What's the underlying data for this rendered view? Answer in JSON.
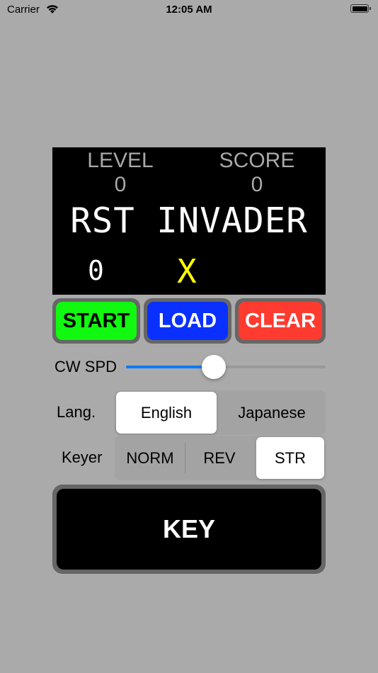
{
  "status_bar": {
    "carrier": "Carrier",
    "time": "12:05 AM",
    "icons": [
      "wifi-icon",
      "battery-icon"
    ]
  },
  "game": {
    "level_label": "LEVEL",
    "level_value": "0",
    "score_label": "SCORE",
    "score_value": "0",
    "title": "RST INVADER",
    "input_count": "0",
    "target_char": "X",
    "colors": {
      "background": "#000000",
      "stats": "#a8a8a8",
      "title": "#ffffff",
      "target": "#ffff00"
    }
  },
  "controls": {
    "start_label": "START",
    "load_label": "LOAD",
    "clear_label": "CLEAR",
    "colors": {
      "start": "#11f811",
      "load": "#0a30ff",
      "clear": "#ff3b30"
    }
  },
  "speed": {
    "label": "CW SPD",
    "value_fraction": 0.44,
    "accent": "#0a7aff"
  },
  "language": {
    "label": "Lang.",
    "options": [
      "English",
      "Japanese"
    ],
    "selected": "English"
  },
  "keyer": {
    "label": "Keyer",
    "options": [
      "NORM",
      "REV",
      "STR"
    ],
    "selected": "STR"
  },
  "key": {
    "label": "KEY"
  }
}
